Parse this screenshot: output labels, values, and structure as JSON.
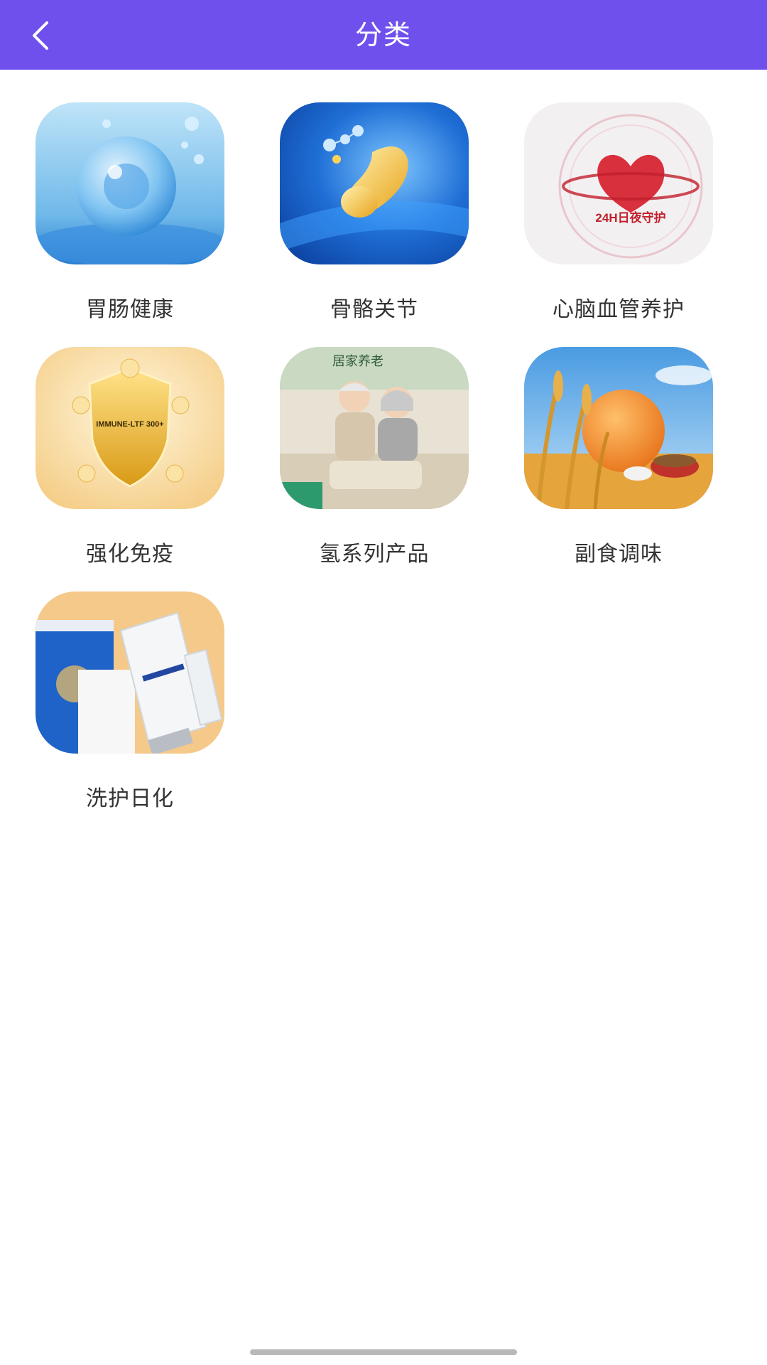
{
  "header": {
    "title": "分类",
    "bg_color": "#7050ec"
  },
  "categories": [
    {
      "label": "胃肠健康",
      "icon": "water-cell-image"
    },
    {
      "label": "骨骼关节",
      "icon": "joint-image"
    },
    {
      "label": "心脑血管养护",
      "icon": "heart-clock-image",
      "image_text": "24H日夜守护"
    },
    {
      "label": "强化免疫",
      "icon": "immune-shield-image",
      "image_text": "IMMUNE-LTF 300+"
    },
    {
      "label": "氢系列产品",
      "icon": "elderly-couple-image",
      "image_text": "居家养老"
    },
    {
      "label": "副食调味",
      "icon": "wheat-grain-image"
    },
    {
      "label": "洗护日化",
      "icon": "skincare-product-image"
    }
  ]
}
